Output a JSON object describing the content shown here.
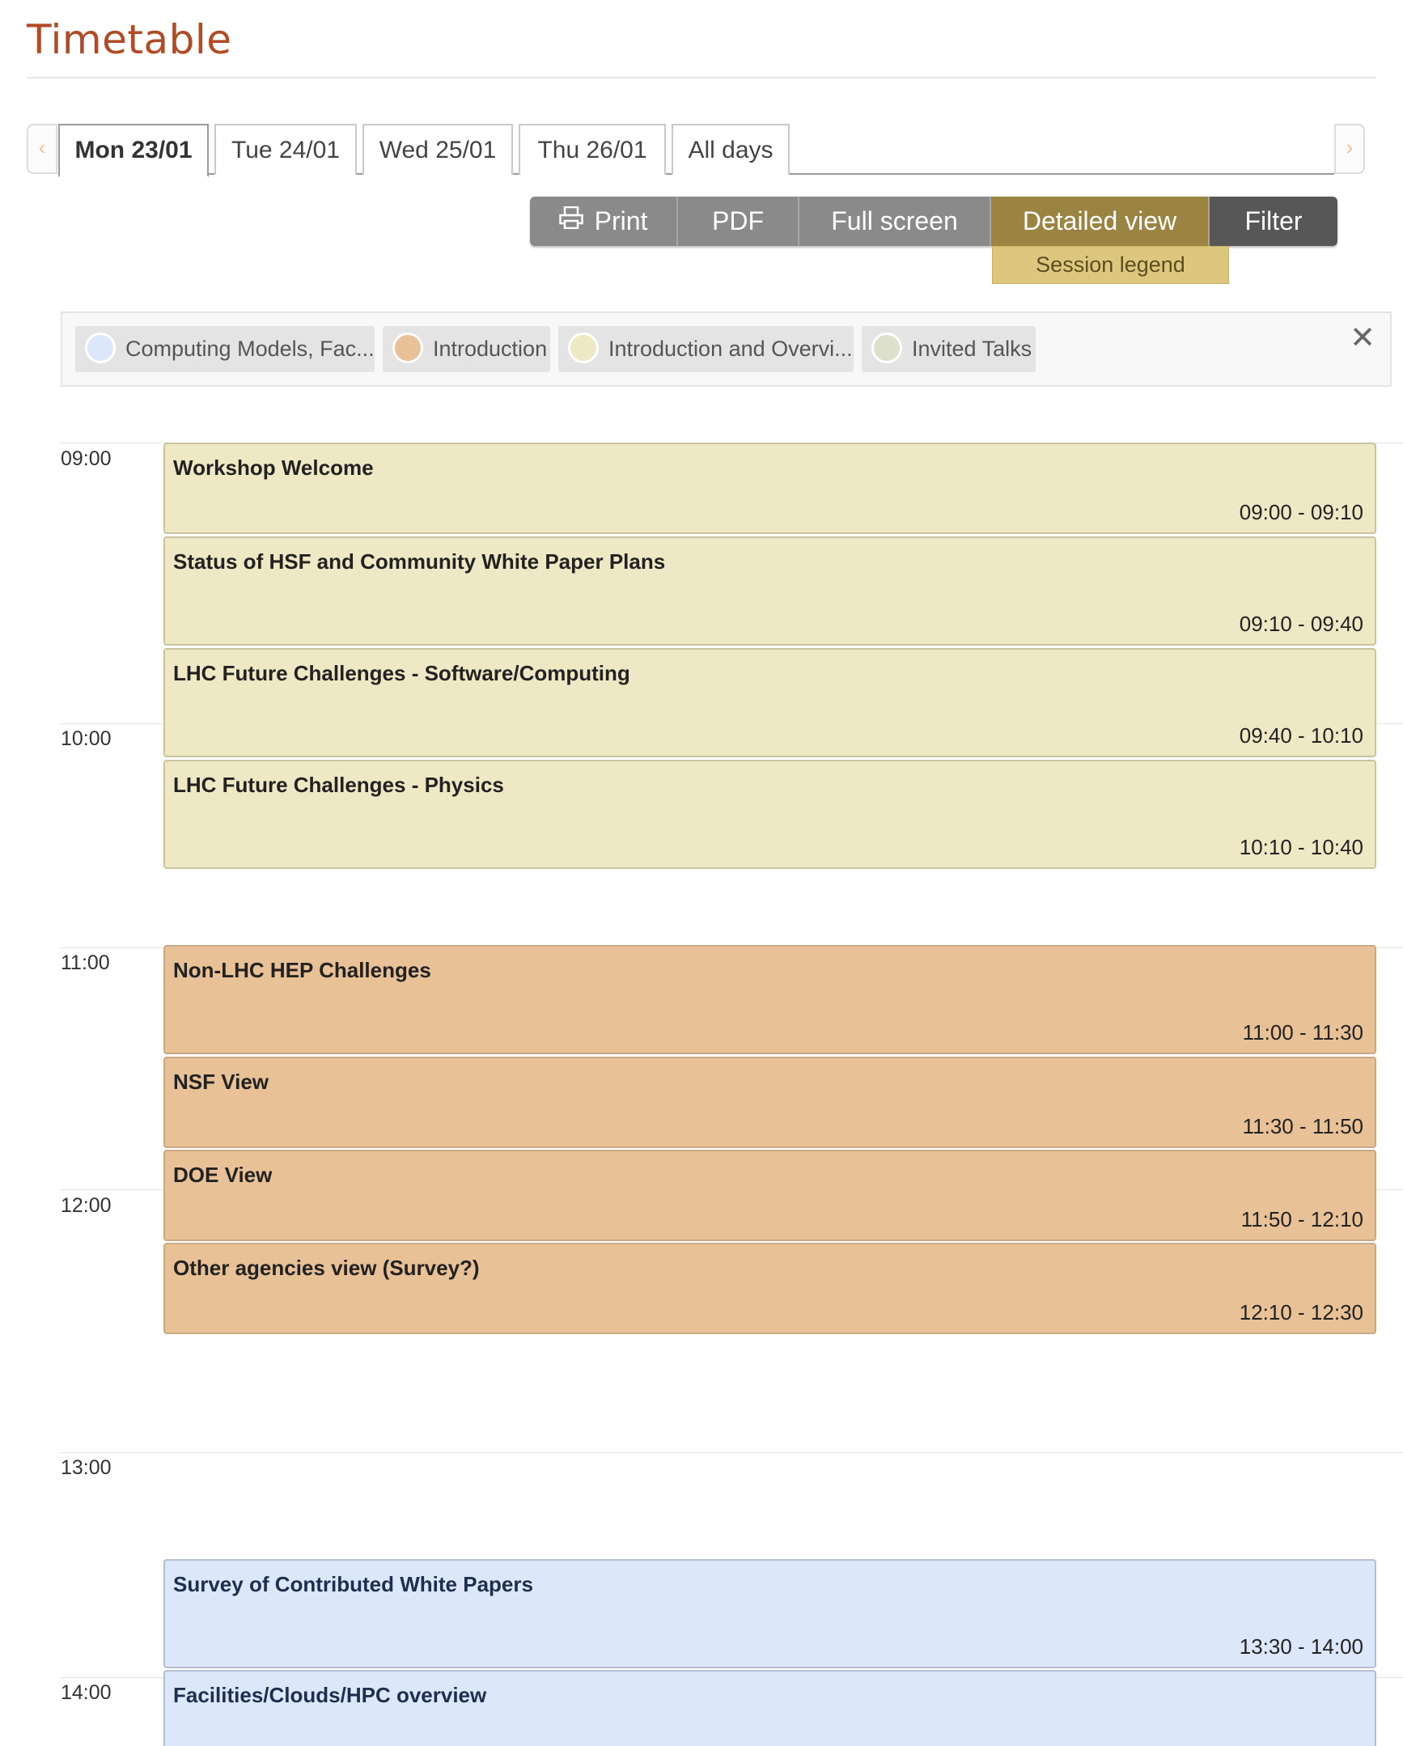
{
  "page": {
    "title": "Timetable"
  },
  "tabs": {
    "prev_icon": "chevron-left-icon",
    "next_icon": "chevron-right-icon",
    "items": [
      {
        "label": "Mon 23/01",
        "active": true
      },
      {
        "label": "Tue 24/01",
        "active": false
      },
      {
        "label": "Wed 25/01",
        "active": false
      },
      {
        "label": "Thu 26/01",
        "active": false
      },
      {
        "label": "All days",
        "active": false
      }
    ]
  },
  "toolbar": {
    "print_label": "Print",
    "print_icon": "printer-icon",
    "pdf_label": "PDF",
    "fullscreen_label": "Full screen",
    "detailed_label": "Detailed view",
    "filter_label": "Filter",
    "session_legend_label": "Session legend"
  },
  "legend": {
    "close_glyph": "✕",
    "items": [
      {
        "label": "Computing Models, Fac...",
        "color": "#dce8f9"
      },
      {
        "label": "Introduction",
        "color": "#e9c196"
      },
      {
        "label": "Introduction and Overvi...",
        "color": "#efe8c4"
      },
      {
        "label": "Invited Talks",
        "color": "#dde1cc"
      }
    ]
  },
  "hours": [
    "09:00",
    "10:00",
    "11:00",
    "12:00",
    "13:00",
    "14:00"
  ],
  "entries": [
    {
      "title": "Workshop Welcome",
      "time": "09:00 - 09:10",
      "session": "overview"
    },
    {
      "title": "Status of HSF and Community White Paper Plans",
      "time": "09:10 - 09:40",
      "session": "overview"
    },
    {
      "title": "LHC Future Challenges - Software/Computing",
      "time": "09:40 - 10:10",
      "session": "overview"
    },
    {
      "title": "LHC Future Challenges - Physics",
      "time": "10:10 - 10:40",
      "session": "overview"
    },
    {
      "title": "Non-LHC HEP Challenges",
      "time": "11:00 - 11:30",
      "session": "intro"
    },
    {
      "title": "NSF View",
      "time": "11:30 - 11:50",
      "session": "intro"
    },
    {
      "title": "DOE View",
      "time": "11:50 - 12:10",
      "session": "intro"
    },
    {
      "title": "Other agencies view (Survey?)",
      "time": "12:10 - 12:30",
      "session": "intro"
    },
    {
      "title": "Survey of Contributed White Papers",
      "time": "13:30 - 14:00",
      "session": "computing"
    },
    {
      "title": "Facilities/Clouds/HPC overview",
      "time": "",
      "session": "computing"
    }
  ]
}
